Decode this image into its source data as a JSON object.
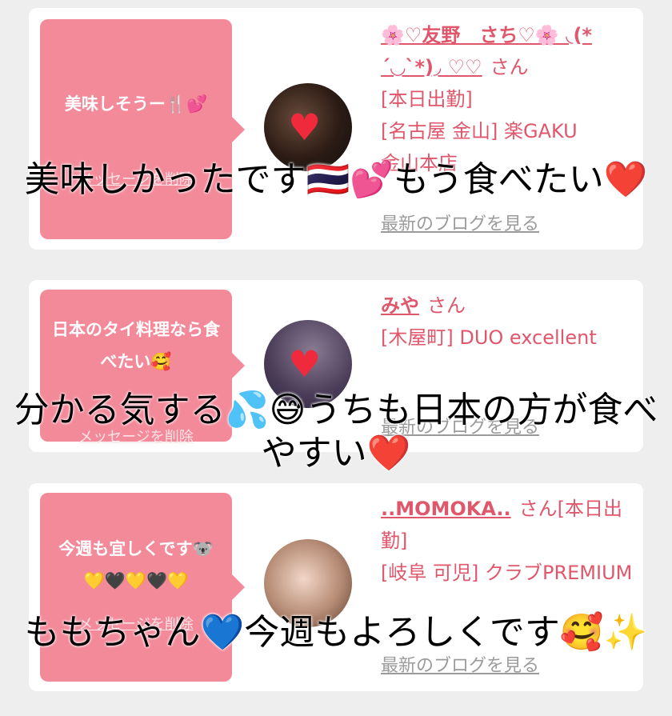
{
  "messages": [
    {
      "message": "美味しそうー🍴💕",
      "delete_label": "メッセージを削除",
      "name": "🌸♡友野　さち♡🌸 ◟(*´◡`*)◞ ♡♡",
      "honorific": "さん",
      "status": "[本日出勤]",
      "location_shop": "[名古屋 金山] 楽GAKU",
      "extra": "金山本店",
      "blog_link": "最新のブログを見る"
    },
    {
      "message": "日本のタイ料理なら食べたい🥰",
      "delete_label": "メッセージを削除",
      "name": "みや",
      "honorific": "さん",
      "location_shop": "[木屋町] DUO excellent",
      "blog_link": "最新のブログを見る"
    },
    {
      "message": "今週も宜しくです🐨💛🖤💛🖤💛",
      "delete_label": "メッセージを削除",
      "name": "..MOMOKA..",
      "honorific": "さん[本日出勤]",
      "location_shop": "[岐阜 可児] クラブPREMIUM",
      "blog_link": "最新のブログを見る"
    }
  ],
  "captions": [
    "美味しかったです🇹🇭💕もう食べたい❤️",
    "分かる気する💦😅うちも日本の方が食べやすい❤️",
    "ももちゃん💙今週もよろしくです🥰✨"
  ],
  "colors": {
    "bubble": "#f38a9a",
    "accent_text": "#e0576c",
    "link_gray": "#9b9b9b",
    "background": "#eeeeee"
  }
}
